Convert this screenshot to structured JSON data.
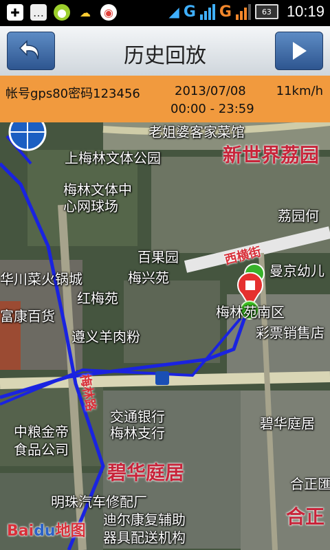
{
  "status_bar": {
    "left_icons": [
      "usb-debug-icon",
      "sms-icon",
      "android-icon",
      "weather-icon",
      "browser-icon"
    ],
    "network_1": "G",
    "network_2": "G",
    "battery": "63",
    "time": "10:19"
  },
  "title_bar": {
    "title": "历史回放",
    "back_icon": "back-arrow-icon",
    "play_icon": "play-icon"
  },
  "info": {
    "account": "帐号gps80密码123456",
    "date": "2013/07/08",
    "speed": "11km/h",
    "time_range": "00:00 - 23:59"
  },
  "map": {
    "labels": {
      "laojiepo": "老姐婆客家菜馆",
      "shangmeilin": "上梅林文体公园",
      "xinshijie": "新世界荔园",
      "meilin_center_1": "梅林文体中",
      "meilin_center_2": "心网球场",
      "liyuan": "荔园何",
      "baiguoyuan": "百果园",
      "xihengjie": "西横街",
      "manjing": "曼京幼儿",
      "huachuan": "华川菜火锅城",
      "meixingyuan": "梅兴苑",
      "hongmeiyuan": "红梅苑",
      "meiyuan_south": "梅林苑南区",
      "fukang": "富康百货",
      "caipiao": "彩票销售店",
      "zunyi": "遵义羊肉粉",
      "zhonggen_1": "中粮金帝",
      "zhonggen_2": "食品公司",
      "bank_1": "交通银行",
      "bank_2": "梅林支行",
      "bihua_right": "碧华庭居",
      "bihua_big": "碧华庭居",
      "hezheng": "合正匯",
      "hezheng_big": "合正",
      "mingzhu": "明珠汽车修配厂",
      "dierkang_1": "迪尔康复辅助",
      "dierkang_2": "器具配送机构",
      "road_vertical": "梅林路"
    },
    "baidu_1": "Bai",
    "baidu_2": "du",
    "baidu_3": "地图",
    "track_color": "#1a23e0",
    "start_color": "#37b22a",
    "stop_color": "#e5302f"
  }
}
